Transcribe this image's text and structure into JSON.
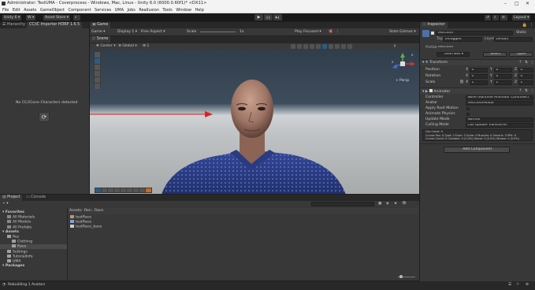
{
  "window": {
    "title": "Administrator: TestUMA - Coverprocess - Windows, Mac, Linux - Unity 6.0 (6000.0.60f1)* <DX11>",
    "controls": [
      "–",
      "□",
      "✕"
    ]
  },
  "menu": [
    "File",
    "Edit",
    "Assets",
    "GameObject",
    "Component",
    "Services",
    "UMA",
    "Jobs",
    "Reallusion",
    "Tools",
    "Window",
    "Help"
  ],
  "toolbar": {
    "account": "Unity 6",
    "cloud": "W",
    "asset_store": "Asset Store",
    "play": "▶",
    "pause": "❙❙",
    "step": "▶❙",
    "layout": "Layout"
  },
  "hierarchy": {
    "tabs": [
      "Hierarchy",
      "CC/iC Importer HDRP 1.6.5"
    ],
    "message": "No CC/iClone Characters detected",
    "refresh_icon": "refresh-icon"
  },
  "scene": {
    "tabs": [
      "Game",
      "Scene"
    ],
    "game_bar": {
      "display_type": "Game",
      "display": "Display 1",
      "aspect": "Free Aspect",
      "scale_label": "Scale",
      "scale_value": "1x",
      "play_mode": "Play Focused",
      "stats": "Stats",
      "gizmos": "Gizmos"
    },
    "scene_bar": {
      "pivot": "Center",
      "space": "Global",
      "snap": "1"
    },
    "gizmo": {
      "label": "< Persp",
      "x": "x",
      "y": "y",
      "z": "z"
    }
  },
  "inspector": {
    "tab": "Inspector",
    "object_name": "TestCloth",
    "static_label": "Static",
    "tag_label": "Tag",
    "tag_value": "Untagged",
    "layer_label": "Layer",
    "layer_value": "Default",
    "prefab_label": "Prefab",
    "prefab_value": "TestCloth",
    "overrides": "Overrides",
    "select": "Select",
    "open": "Open",
    "transform": {
      "title": "Transform",
      "position_label": "Position",
      "rotation_label": "Rotation",
      "scale_label": "Scale",
      "position": [
        "0",
        "0",
        "0"
      ],
      "rotation": [
        "0",
        "0",
        "0"
      ],
      "scale": [
        "1",
        "1",
        "1"
      ],
      "axis": [
        "X",
        "Y",
        "Z"
      ]
    },
    "animator": {
      "title": "Animator",
      "controller_label": "Controller",
      "controller_value": "None (Runtime Animator Controller)",
      "avatar_label": "Avatar",
      "avatar_value": "TestClothAvatar",
      "root_motion_label": "Apply Root Motion",
      "physics_label": "Animate Physics",
      "update_mode_label": "Update Mode",
      "update_mode_value": "Normal",
      "culling_label": "Culling Mode",
      "culling_value": "Cull Update Transforms",
      "info": [
        "Clip Count: 0",
        "Curves Pos: 0 Quat: 0 Euler: 0 Scale: 0 Muscles: 0 Generic: 0 PPtr: 0",
        "Curves Count: 0 Constant: 0 (0.0%) Dense: 0 (0.0%) Stream: 0 (0.0%)"
      ]
    },
    "add_component": "Add Component"
  },
  "project": {
    "tabs": [
      "Project",
      "Console"
    ],
    "add": "+ ▾",
    "tree": [
      {
        "label": "Favorites",
        "bold": true,
        "indent": 0
      },
      {
        "label": "All Materials",
        "bold": false,
        "indent": 1
      },
      {
        "label": "All Models",
        "bold": false,
        "indent": 1
      },
      {
        "label": "All Prefabs",
        "bold": false,
        "indent": 1
      },
      {
        "label": "Assets",
        "bold": true,
        "indent": 0
      },
      {
        "label": "Res",
        "bold": false,
        "indent": 1
      },
      {
        "label": "Clothing",
        "bold": false,
        "indent": 2
      },
      {
        "label": "Race",
        "bold": false,
        "indent": 2
      },
      {
        "label": "Settings",
        "bold": false,
        "indent": 1
      },
      {
        "label": "TutorialInfo",
        "bold": false,
        "indent": 1
      },
      {
        "label": "UMA",
        "bold": false,
        "indent": 1
      },
      {
        "label": "Packages",
        "bold": true,
        "indent": 0
      }
    ],
    "breadcrumb": [
      "Assets",
      "Res",
      "Race"
    ],
    "files": [
      "testRace",
      "testRace",
      "testRace_base"
    ]
  },
  "status": {
    "text": "Rebuilding 1 Avatars"
  },
  "colors": {
    "panel": "#383838",
    "dark": "#282828",
    "selection": "#2c5d87",
    "arrow": "#e02020",
    "shirt": "#2b3f8c"
  }
}
